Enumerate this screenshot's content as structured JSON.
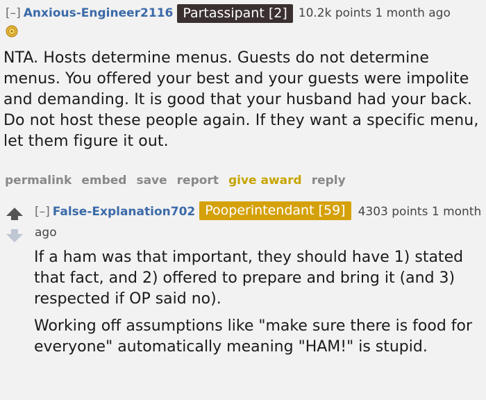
{
  "comment1": {
    "expand": "[–]",
    "author": "Anxious-Engineer2116",
    "flair": "Partassipant [2]",
    "score": "10.2k points 1 month ago",
    "award_icon": "gold-medal-icon",
    "body": "NTA. Hosts determine menus. Guests do not determine menus. You offered your best and your guests were impolite and demanding. It is good that your husband had your back. Do not host these people again. If they want a specific menu, let them figure it out.",
    "buttons": {
      "permalink": "permalink",
      "embed": "embed",
      "save": "save",
      "report": "report",
      "give_award": "give award",
      "reply": "reply"
    },
    "colors": {
      "author": "#3b6aa8",
      "flair_bg": "#3b3030",
      "award": "#c6a400"
    }
  },
  "comment2": {
    "expand": "[–]",
    "author": "False-Explanation702",
    "flair": "Pooperintendant [59]",
    "score": "4303 points 1 month ago",
    "paragraphs": [
      "If a ham was that important, they should have 1) stated that fact, and 2) offered to prepare and bring it (and 3) respected if OP said no).",
      "Working off assumptions like \"make sure there is food for everyone\" automatically meaning \"HAM!\" is stupid."
    ],
    "icons": {
      "upvote": "upvote-arrow-icon",
      "downvote": "downvote-arrow-icon"
    },
    "colors": {
      "flair_bg": "#d5a10a"
    }
  }
}
